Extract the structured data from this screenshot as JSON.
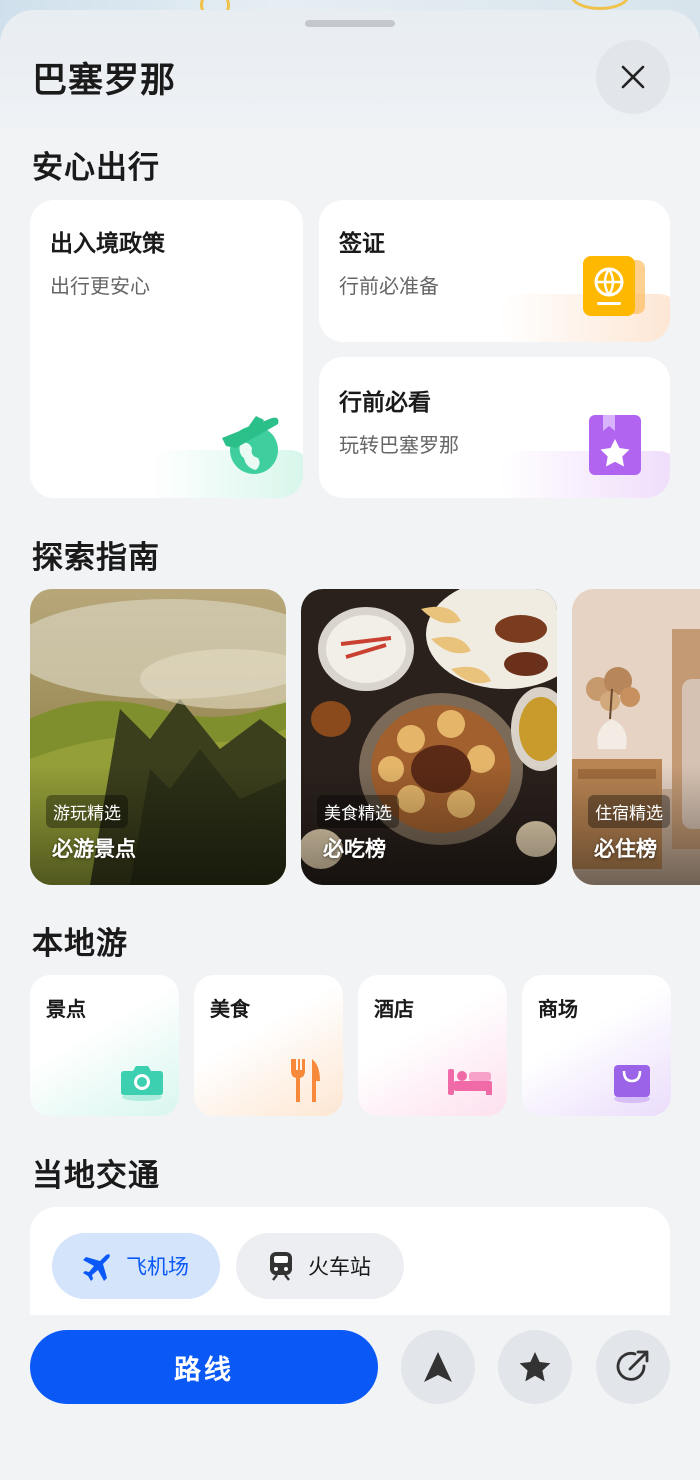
{
  "header": {
    "city": "巴塞罗那"
  },
  "sections": {
    "safe_travel": "安心出行",
    "guides": "探索指南",
    "local_tour": "本地游",
    "transport": "当地交通"
  },
  "safe_cards": [
    {
      "title": "出入境政策",
      "subtitle": "出行更安心",
      "icon": "plane-globe-icon"
    },
    {
      "title": "签证",
      "subtitle": "行前必准备",
      "icon": "passport-icon"
    },
    {
      "title": "行前必看",
      "subtitle": "玩转巴塞罗那",
      "icon": "bookmark-star-icon"
    }
  ],
  "guides": [
    {
      "tag": "游玩精选",
      "title": "必游景点"
    },
    {
      "tag": "美食精选",
      "title": "必吃榜"
    },
    {
      "tag": "住宿精选",
      "title": "必住榜"
    }
  ],
  "local": [
    {
      "label": "景点",
      "icon": "camera-icon",
      "color": "#3ccfb0"
    },
    {
      "label": "美食",
      "icon": "cutlery-icon",
      "color": "#f7893a"
    },
    {
      "label": "酒店",
      "icon": "bed-icon",
      "color": "#f06aa8"
    },
    {
      "label": "商场",
      "icon": "shopping-bag-icon",
      "color": "#9b63e8"
    }
  ],
  "transport_tabs": [
    {
      "label": "飞机场",
      "icon": "airplane-icon",
      "selected": true
    },
    {
      "label": "火车站",
      "icon": "train-icon",
      "selected": false
    }
  ],
  "bottom": {
    "route_label": "路线",
    "buttons": [
      "navigate-icon",
      "star-icon",
      "share-icon"
    ]
  },
  "colors": {
    "accent": "#0a59f7",
    "selected_pill_bg": "#d4e4fb"
  }
}
